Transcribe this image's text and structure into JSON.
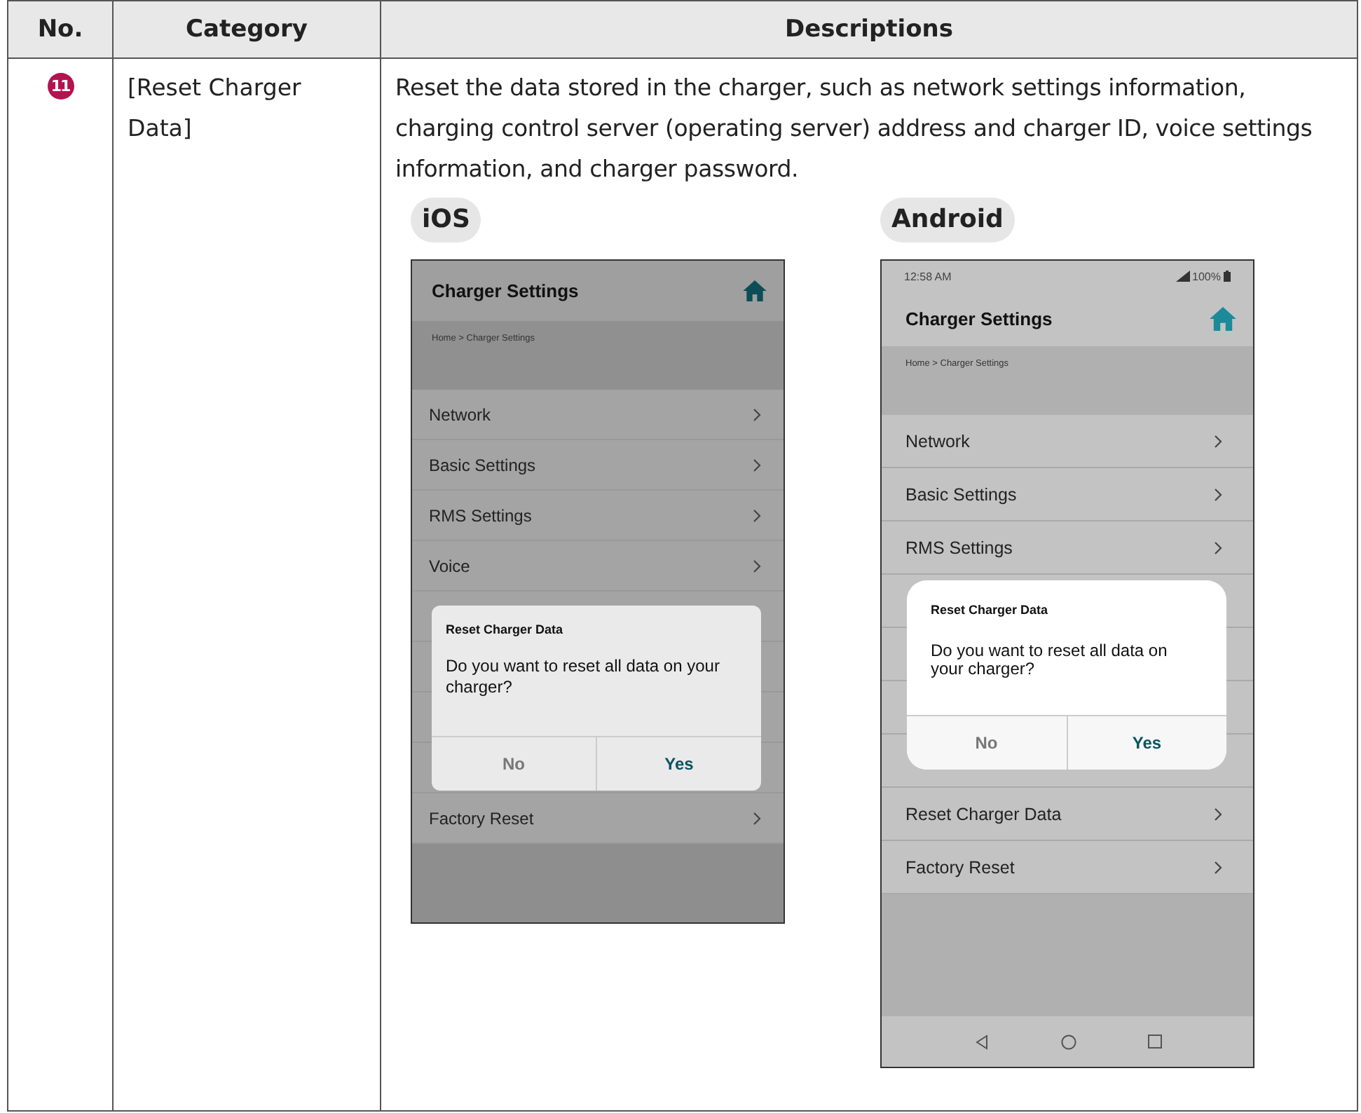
{
  "table": {
    "columns": [
      "No.",
      "Category",
      "Descriptions"
    ],
    "rows": [
      {
        "number": "11",
        "category": "[Reset Charger Data]",
        "description": "Reset the data stored in the charger, such as network settings information, charging control server (operating server) address and charger ID, voice settings information, and charger password.",
        "screenshots": [
          {
            "kind": "ios",
            "platform": "iOS",
            "title": "Charger Settings",
            "breadcrumb": "Home > Charger Settings",
            "menu": [
              {
                "label": "Network"
              },
              {
                "label": "Basic Settings"
              },
              {
                "label": "RMS Settings"
              },
              {
                "label": "Voice"
              },
              {
                "label": "Factory Reset"
              }
            ],
            "dialog": {
              "title": "Reset Charger Data",
              "message": "Do you want to reset all data on your charger?",
              "buttons": [
                "No",
                "Yes"
              ]
            }
          },
          {
            "kind": "android",
            "platform": "Android",
            "time": "12:58 AM",
            "battery": "100%",
            "title": "Charger Settings",
            "breadcrumb": "Home > Charger Settings",
            "menu": [
              {
                "label": "Network"
              },
              {
                "label": "Basic Settings"
              },
              {
                "label": "RMS Settings"
              },
              {
                "label": "Reset Charger Data"
              },
              {
                "label": "Factory Reset"
              }
            ],
            "dialog": {
              "title": "Reset Charger Data",
              "message": "Do you want to reset all data on your charger?",
              "buttons": [
                "No",
                "Yes"
              ]
            }
          }
        ]
      }
    ]
  }
}
